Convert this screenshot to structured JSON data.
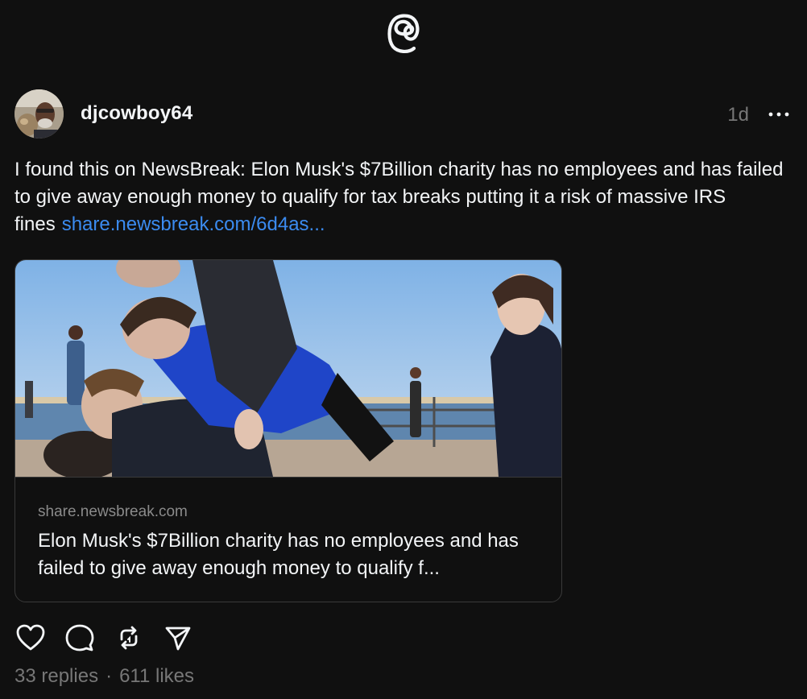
{
  "header": {
    "logo_icon": "threads-logo-icon"
  },
  "post": {
    "username": "djcowboy64",
    "timestamp": "1d",
    "more_icon": "more-horizontal-icon",
    "text": "I found this on NewsBreak: Elon Musk's $7Billion charity has no employees and has failed to give away enough money to qualify for tax breaks putting it a risk of massive IRS fines",
    "link_text": "share.newsbreak.com/6d4as...",
    "link_card": {
      "domain": "share.newsbreak.com",
      "title": "Elon Musk's $7Billion charity has no employees and has failed to give away enough money to qualify f..."
    },
    "actions": [
      {
        "name": "like-button",
        "icon": "heart-icon"
      },
      {
        "name": "reply-button",
        "icon": "comment-icon"
      },
      {
        "name": "repost-button",
        "icon": "repost-icon"
      },
      {
        "name": "share-button",
        "icon": "send-icon"
      }
    ],
    "stats": {
      "replies": "33 replies",
      "separator": "·",
      "likes": "611 likes"
    }
  },
  "colors": {
    "background": "#101010",
    "text": "#f3f5f7",
    "muted": "#777777",
    "link": "#3b8bf0",
    "border": "#3a3a3a"
  }
}
